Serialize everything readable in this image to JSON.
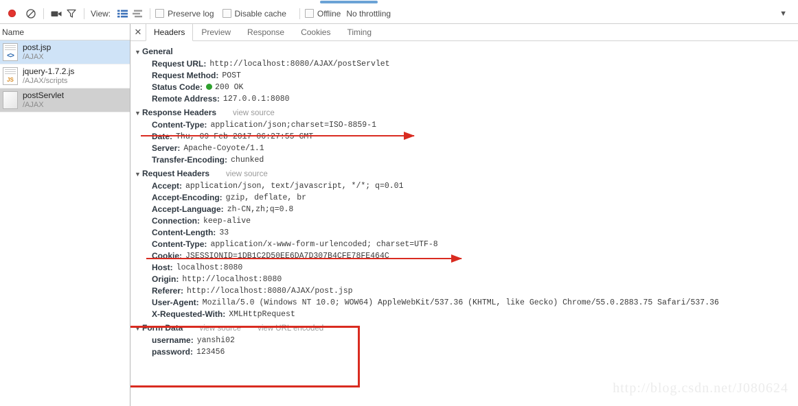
{
  "toolbar": {
    "record_icon": "record-dot-icon",
    "clear_icon": "clear-prohibited-icon",
    "camera_icon": "camera-icon",
    "filter_icon": "funnel-filter-icon",
    "view_label": "View:",
    "view_list_icon": "list-view-icon",
    "view_waterfall_icon": "waterfall-view-icon",
    "checkboxes": [
      {
        "label": "Preserve log",
        "checked": false
      },
      {
        "label": "Disable cache",
        "checked": false
      },
      {
        "label": "Offline",
        "checked": false
      }
    ],
    "throttling": "No throttling",
    "caret_icon": "chevron-down-icon"
  },
  "sidebar": {
    "column_header": "Name",
    "files": [
      {
        "name": "post.jsp",
        "path": "/AJAX",
        "icon": "jsp-file-icon",
        "badge": "<>",
        "state": "selected"
      },
      {
        "name": "jquery-1.7.2.js",
        "path": "/AJAX/scripts",
        "icon": "js-file-icon",
        "badge": "JS",
        "state": "normal"
      },
      {
        "name": "postServlet",
        "path": "/AJAX",
        "icon": "blank-file-icon",
        "badge": "",
        "state": "active"
      }
    ]
  },
  "detail": {
    "close_icon": "close-icon",
    "tabs": [
      {
        "label": "Headers",
        "active": true
      },
      {
        "label": "Preview",
        "active": false
      },
      {
        "label": "Response",
        "active": false
      },
      {
        "label": "Cookies",
        "active": false
      },
      {
        "label": "Timing",
        "active": false
      }
    ],
    "sections": [
      {
        "title": "General",
        "caret": "▼",
        "view_source": "",
        "view_url_encoded": "",
        "rows": [
          {
            "key": "Request URL:",
            "value": "http://localhost:8080/AJAX/postServlet"
          },
          {
            "key": "Request Method:",
            "value": "POST"
          },
          {
            "key": "Status Code:",
            "value": "200 OK",
            "status_dot": true
          },
          {
            "key": "Remote Address:",
            "value": "127.0.0.1:8080"
          }
        ]
      },
      {
        "title": "Response Headers",
        "caret": "▼",
        "view_source": "view source",
        "view_url_encoded": "",
        "rows": [
          {
            "key": "Content-Type:",
            "value": "application/json;charset=ISO-8859-1"
          },
          {
            "key": "Date:",
            "value": "Thu, 09 Feb 2017 06:27:55 GMT"
          },
          {
            "key": "Server:",
            "value": "Apache-Coyote/1.1"
          },
          {
            "key": "Transfer-Encoding:",
            "value": "chunked"
          }
        ]
      },
      {
        "title": "Request Headers",
        "caret": "▼",
        "view_source": "view source",
        "view_url_encoded": "",
        "rows": [
          {
            "key": "Accept:",
            "value": "application/json, text/javascript, */*; q=0.01"
          },
          {
            "key": "Accept-Encoding:",
            "value": "gzip, deflate, br"
          },
          {
            "key": "Accept-Language:",
            "value": "zh-CN,zh;q=0.8"
          },
          {
            "key": "Connection:",
            "value": "keep-alive"
          },
          {
            "key": "Content-Length:",
            "value": "33"
          },
          {
            "key": "Content-Type:",
            "value": "application/x-www-form-urlencoded; charset=UTF-8"
          },
          {
            "key": "Cookie:",
            "value": "JSESSIONID=1DB1C2D50EE6DA7D307B4CFE78FE464C"
          },
          {
            "key": "Host:",
            "value": "localhost:8080"
          },
          {
            "key": "Origin:",
            "value": "http://localhost:8080"
          },
          {
            "key": "Referer:",
            "value": "http://localhost:8080/AJAX/post.jsp"
          },
          {
            "key": "User-Agent:",
            "value": "Mozilla/5.0 (Windows NT 10.0; WOW64) AppleWebKit/537.36 (KHTML, like Gecko) Chrome/55.0.2883.75 Safari/537.36"
          },
          {
            "key": "X-Requested-With:",
            "value": "XMLHttpRequest"
          }
        ]
      },
      {
        "title": "Form Data",
        "caret": "▼",
        "view_source": "view source",
        "view_url_encoded": "view URL encoded",
        "rows": [
          {
            "key": "username:",
            "value": "yanshi02"
          },
          {
            "key": "password:",
            "value": "123456"
          }
        ]
      }
    ]
  },
  "annotations": {
    "accent_color": "#d92b20",
    "arrows": 2,
    "highlight_box": "form-data-highlight"
  },
  "watermark": "http://blog.csdn.net/J080624"
}
